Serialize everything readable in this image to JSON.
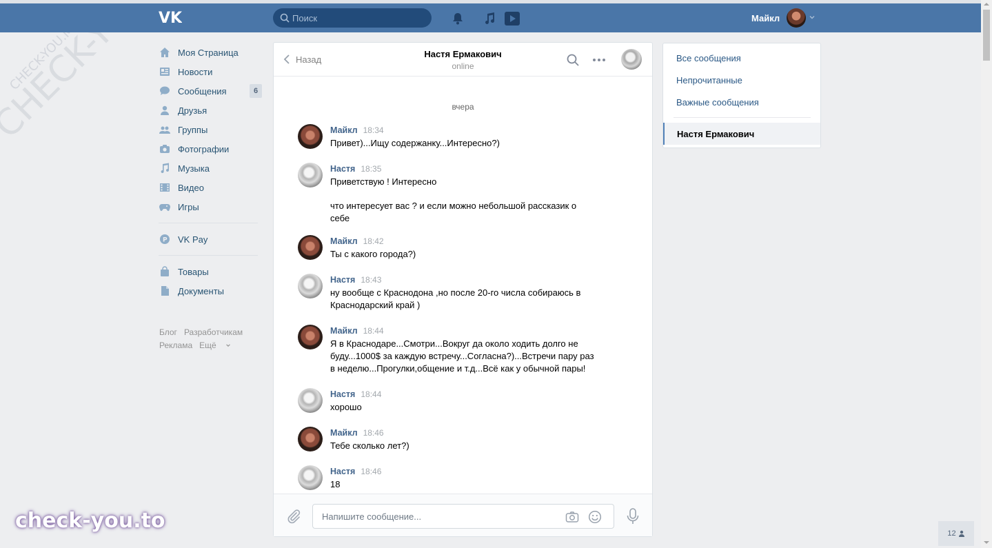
{
  "header": {
    "search_placeholder": "Поиск",
    "user_name": "Майкл"
  },
  "menu": {
    "items": [
      {
        "label": "Моя Страница",
        "icon": "home-icon"
      },
      {
        "label": "Новости",
        "icon": "news-icon"
      },
      {
        "label": "Сообщения",
        "icon": "messages-icon",
        "badge": "6"
      },
      {
        "label": "Друзья",
        "icon": "friends-icon"
      },
      {
        "label": "Группы",
        "icon": "groups-icon"
      },
      {
        "label": "Фотографии",
        "icon": "photos-icon"
      },
      {
        "label": "Музыка",
        "icon": "music-icon"
      },
      {
        "label": "Видео",
        "icon": "video-icon"
      },
      {
        "label": "Игры",
        "icon": "games-icon"
      }
    ],
    "vkpay": "VK Pay",
    "goods": "Товары",
    "documents": "Документы"
  },
  "footer": {
    "blog": "Блог",
    "developers": "Разработчикам",
    "ads": "Реклама",
    "more": "Ещё"
  },
  "chat": {
    "back_label": "Назад",
    "title": "Настя Ермакович",
    "status": "online",
    "day_label": "вчера",
    "messages": [
      {
        "author": "Майкл",
        "time": "18:34",
        "text": "Привет)...Ищу содержанку...Интересно?)"
      },
      {
        "author": "Настя",
        "time": "18:35",
        "text": "Приветствую ! Интересно\n\nчто интересует вас ? и если можно небольшой рассказик о\nсебе"
      },
      {
        "author": "Майкл",
        "time": "18:42",
        "text": "Ты с какого города?)"
      },
      {
        "author": "Настя",
        "time": "18:43",
        "text": "ну вообще с Краснодона ,но после 20-го числа собираюсь в\nКраснодарский край )"
      },
      {
        "author": "Майкл",
        "time": "18:44",
        "text": "Я в Краснодаре...Смотри...Вокруг да около ходить долго не\nбуду...1000$ за каждую встречу...Согласна?)...Встречи пару раз\nв неделю...Прогулки,общение и т.д...Всё как у обычной пары!"
      },
      {
        "author": "Настя",
        "time": "18:44",
        "text": "хорошо"
      },
      {
        "author": "Майкл",
        "time": "18:46",
        "text": "Тебе сколько лет?)"
      },
      {
        "author": "Настя",
        "time": "18:46",
        "text": "18"
      }
    ],
    "composer_placeholder": "Напишите сообщение..."
  },
  "filters": {
    "all": "Все сообщения",
    "unread": "Непрочитанные",
    "important": "Важные сообщения",
    "active_dialog": "Настя Ермакович"
  },
  "people_widget": "12",
  "watermark": {
    "bottom": "check-you.to",
    "diagonal": "CHECK-YOU.ME",
    "diagonal_small": "CHECK-YOU.ME"
  },
  "colors": {
    "header_bg": "#4a76a8",
    "link": "#2a5885",
    "author": "#42648b",
    "page_bg": "#edeef0"
  }
}
